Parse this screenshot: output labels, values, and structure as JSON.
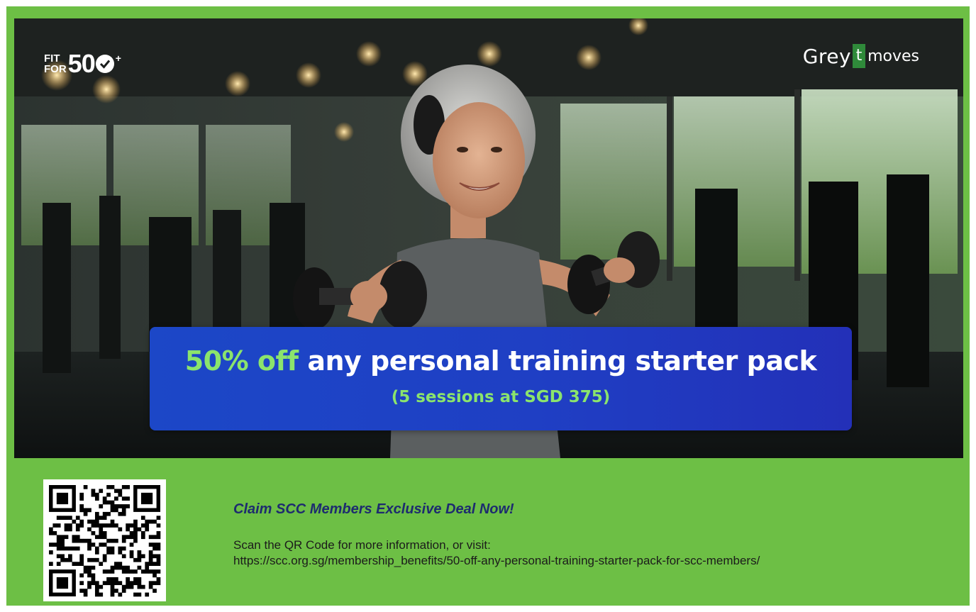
{
  "logos": {
    "fit_small_1": "FIT",
    "fit_small_2": "FOR",
    "fit_big": "50",
    "fit_plus": "+",
    "greytt_word": "Grey",
    "greytt_box": "t",
    "greytt_moves": "moves",
    "check_icon": "check-circle-icon"
  },
  "banner": {
    "accent": "50% off",
    "headline_rest": " any personal training starter pack",
    "sub": "(5 sessions at SGD 375)"
  },
  "footer": {
    "cta": "Claim SCC Members Exclusive Deal Now!",
    "info_line1": "Scan the QR Code for more information, or visit:",
    "info_line2": "https://scc.org.sg/membership_benefits/50-off-any-personal-training-starter-pack-for-scc-members/"
  },
  "colors": {
    "panel_green": "#6dbf45",
    "banner_blue": "#1f3fc4",
    "accent_green": "#8be46c",
    "cta_navy": "#1d2b6f"
  }
}
